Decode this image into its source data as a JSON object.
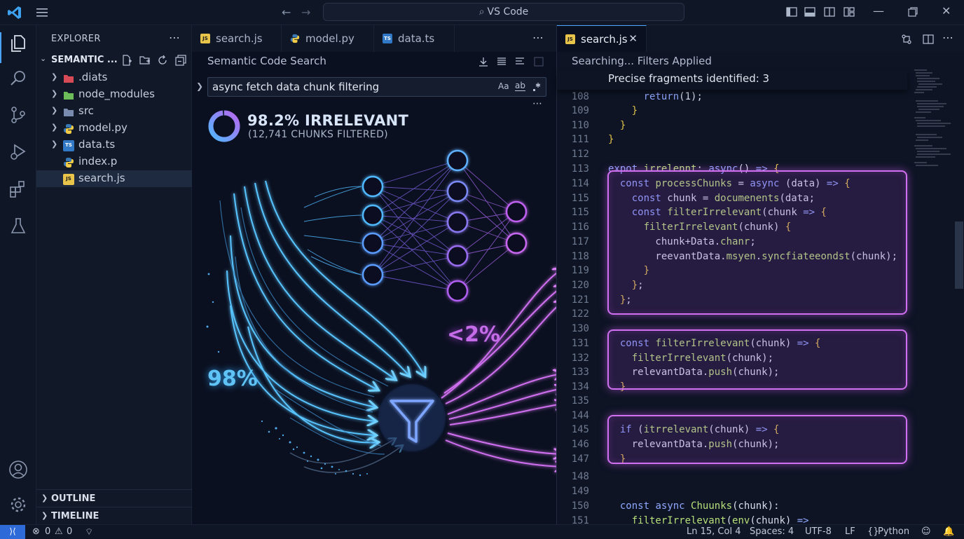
{
  "titlebar": {
    "command_center": "VS Code"
  },
  "sidebar": {
    "header": "EXPLORER",
    "project": "SEMANTIC ...",
    "items": [
      {
        "label": ".diats",
        "icon": "folder-red-icon",
        "color": "#e0505a"
      },
      {
        "label": "node_modules",
        "icon": "folder-green-icon",
        "color": "#6cbd5a"
      },
      {
        "label": "src",
        "icon": "folder-icon",
        "color": "#7a8bb0"
      },
      {
        "label": "model.py",
        "icon": "python-icon"
      },
      {
        "label": "data.ts",
        "icon": "typescript-icon"
      },
      {
        "label": "index.p",
        "icon": "python-icon"
      },
      {
        "label": "search.js",
        "icon": "javascript-icon"
      }
    ],
    "outline": "OUTLINE",
    "timeline": "TIMELINE"
  },
  "group1": {
    "tabs": [
      {
        "label": "search.js",
        "icon": "javascript-icon"
      },
      {
        "label": "model.py",
        "icon": "python-icon"
      },
      {
        "label": "data.ts",
        "icon": "typescript-icon"
      }
    ],
    "panel_title": "Semantic Code Search",
    "search_value": "async fetch data chunk filtering",
    "search_options": {
      "match_case": "Aa",
      "whole_word": "ab"
    },
    "viz": {
      "irrelevant_pct": "98.2% IRRELEVANT",
      "filtered_text": "(12,741 CHUNKS FILTERED)",
      "left_label": "98%",
      "right_label": "<2%",
      "donut_fraction": 0.982,
      "colors": {
        "irrelevant": "#4fb8ff",
        "relevant": "#d070f0"
      }
    }
  },
  "group2": {
    "tab": {
      "label": "search.js",
      "icon": "javascript-icon"
    },
    "status": "Searching... Filters Applied",
    "found": "Precise fragments identified: 3",
    "lines": [
      {
        "n": "108",
        "code": "      return(1);"
      },
      {
        "n": "109",
        "code": "    }"
      },
      {
        "n": "110",
        "code": "  }"
      },
      {
        "n": "111",
        "code": "}"
      },
      {
        "n": "112",
        "code": ""
      },
      {
        "n": "113",
        "code": "expot irrelennt: async() => {"
      },
      {
        "n": "114",
        "code": "  const processChunks = async (data) => {"
      },
      {
        "n": "115",
        "code": "    const chunk = documenents(data;"
      },
      {
        "n": "115",
        "code": "    const filterIrrelevant(chunk => {"
      },
      {
        "n": "116",
        "code": "      filterIrrelevant(chunk) {"
      },
      {
        "n": "117",
        "code": "        chunk+Data.chanr;"
      },
      {
        "n": "118",
        "code": "        reevantData.msyen.syncfiateeondst(chunk);"
      },
      {
        "n": "119",
        "code": "      }"
      },
      {
        "n": "120",
        "code": "    };"
      },
      {
        "n": "121",
        "code": "  };"
      },
      {
        "n": "122",
        "code": ""
      },
      {
        "n": "130",
        "code": ""
      },
      {
        "n": "131",
        "code": "  const filterIrrelevant(chunk) => {"
      },
      {
        "n": "132",
        "code": "    filterIrrelevant(chunk);"
      },
      {
        "n": "133",
        "code": "    relevantData.push(chunk);"
      },
      {
        "n": "134",
        "code": "  }"
      },
      {
        "n": "135",
        "code": ""
      },
      {
        "n": "144",
        "code": ""
      },
      {
        "n": "145",
        "code": "  if (itrrelevant(chunk) => {"
      },
      {
        "n": "146",
        "code": "    relevantData.push(chunk);"
      },
      {
        "n": "147",
        "code": "  }"
      },
      {
        "n": "148",
        "code": ""
      },
      {
        "n": "149",
        "code": ""
      },
      {
        "n": "150",
        "code": "  const async Chuunks(chunk):"
      },
      {
        "n": "151",
        "code": "    filterIrrelevant(env(chunk) =>"
      }
    ],
    "highlight_color": "#d070f0"
  },
  "statusbar": {
    "errors": "0",
    "warnings": "0",
    "position": "Ln 15, Col 4",
    "spaces": "Spaces: 4",
    "encoding": "UTF-8",
    "eol": "LF",
    "language": "Python"
  }
}
